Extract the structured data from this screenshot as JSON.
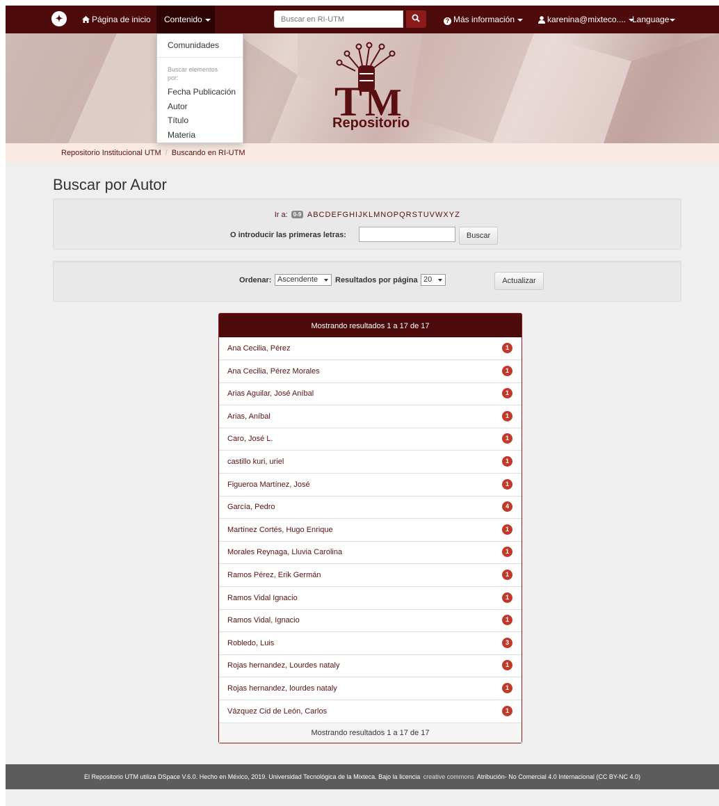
{
  "navbar": {
    "home_label": "Página de inicio",
    "content_label": "Contenido",
    "search_placeholder": "Buscar en RI-UTM",
    "info_label": "Más información",
    "user_label": "karenina@mixteco....",
    "language_label": "Language"
  },
  "dropdown": {
    "communities": "Comunidades",
    "browse_header": "Buscar elementos por:",
    "items": [
      "Fecha Publicación",
      "Autor",
      "Título",
      "Materia"
    ]
  },
  "banner": {
    "logo_text": "Repositorio",
    "colors": {
      "accent": "#4e0b0b",
      "logo": "#5a1010"
    }
  },
  "breadcrumb": {
    "root": "Repositorio Institucional UTM",
    "current": "Buscando en RI-UTM"
  },
  "page_title": "Buscar por Autor",
  "jump": {
    "label": "Ir a:",
    "numeric": "0-9",
    "letters": [
      "A",
      "B",
      "C",
      "D",
      "E",
      "F",
      "G",
      "H",
      "I",
      "J",
      "K",
      "L",
      "M",
      "N",
      "O",
      "P",
      "Q",
      "R",
      "S",
      "T",
      "U",
      "V",
      "W",
      "X",
      "Y",
      "Z"
    ],
    "starts_label": "O introducir las primeras letras:",
    "button": "Buscar"
  },
  "sort": {
    "order_label": "Ordenar:",
    "order_value": "Ascendente",
    "rpp_label": "Resultados por página",
    "rpp_value": "20",
    "button": "Actualizar"
  },
  "results": {
    "header": "Mostrando resultados 1 a 17 de 17",
    "footer": "Mostrando resultados 1 a 17 de 17",
    "rows": [
      {
        "name": "Ana Cecilia, Pérez",
        "count": "1"
      },
      {
        "name": "Ana Cecilia, Pérez Morales",
        "count": "1"
      },
      {
        "name": "Arias Aguilar, José Aníbal",
        "count": "1"
      },
      {
        "name": "Arias, Aníbal",
        "count": "1"
      },
      {
        "name": "Caro, José L.",
        "count": "1"
      },
      {
        "name": "castillo kuri, uriel",
        "count": "1"
      },
      {
        "name": "Figueroa Martínez, José",
        "count": "1"
      },
      {
        "name": "García, Pedro",
        "count": "4"
      },
      {
        "name": "Martínez Cortés, Hugo Enrique",
        "count": "1"
      },
      {
        "name": "Morales Reynaga, Lluvia Carolina",
        "count": "1"
      },
      {
        "name": "Ramos Pérez, Erik Germán",
        "count": "1"
      },
      {
        "name": "Ramos Vidal Ignacio",
        "count": "1"
      },
      {
        "name": "Ramos Vidal, Ignacio",
        "count": "1"
      },
      {
        "name": "Robledo, Luis",
        "count": "3"
      },
      {
        "name": "Rojas hernandez, Lourdes nataly",
        "count": "1"
      },
      {
        "name": "Rojas hernandez, lourdes nataly",
        "count": "1"
      },
      {
        "name": "Vázquez Cid de León, Carlos",
        "count": "1"
      }
    ]
  },
  "footer": {
    "text_before": "El Repositorio UTM utiliza DSpace V.6.0. Hecho en México, 2019. Universidad Tecnológica de la Mixteca. Bajo la licencia",
    "cc_logo": "creative commons",
    "text_after": "Atribución- No Comercial 4.0 Internacional (CC BY-NC 4.0)"
  }
}
